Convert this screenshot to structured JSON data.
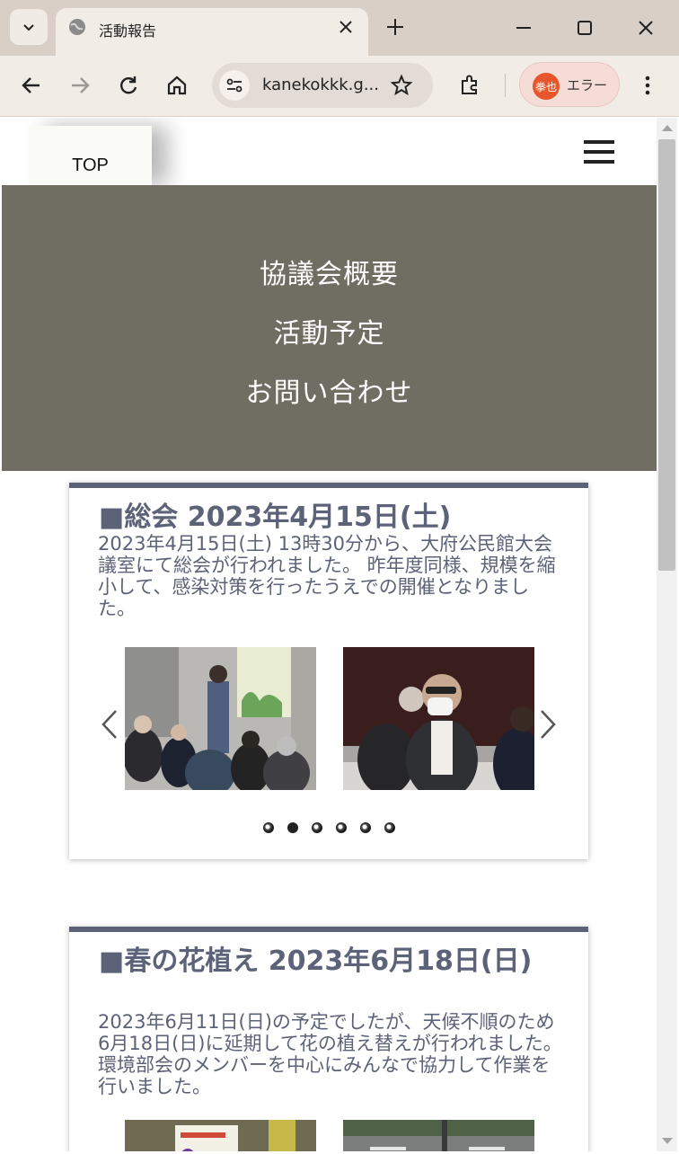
{
  "browser": {
    "tab_title": "活動報告",
    "url": "kanekokkk.g...",
    "profile_avatar": "拳也",
    "profile_label": "エラー"
  },
  "site": {
    "top_label": "TOP",
    "nav": [
      "協議会概要",
      "活動予定",
      "お問い合わせ"
    ]
  },
  "posts": [
    {
      "title": "■総会 2023年4月15日(土)",
      "body": "2023年4月15日(土) 13時30分から、大府公民館大会議室にて総会が行われました。 昨年度同様、規模を縮小して、感染対策を行ったうえでの開催となりました。",
      "slides": 6,
      "active_slide": 1
    },
    {
      "title": "■春の花植え 2023年6月18日(日)",
      "body": "2023年6月11日(日)の予定でしたが、天候不順のため6月18日(日)に延期して花の植え替えが行われました。 環境部会のメンバーを中心にみんなで協力して作業を行いました。"
    }
  ],
  "colors": {
    "nav_bg": "#706d62",
    "accent": "#5c6277"
  }
}
